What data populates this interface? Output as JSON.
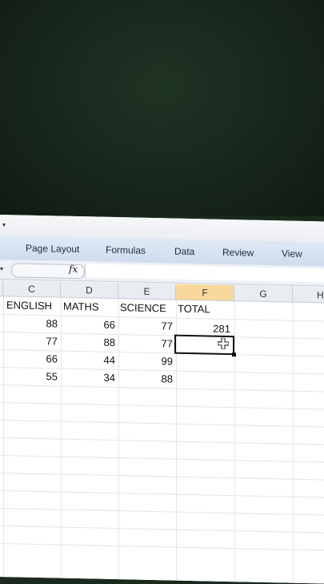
{
  "ribbon": {
    "tabs": [
      "Page Layout",
      "Formulas",
      "Data",
      "Review",
      "View"
    ]
  },
  "formula_bar": {
    "fx_label": "fx",
    "value": ""
  },
  "columns": [
    "C",
    "D",
    "E",
    "F",
    "G",
    "H"
  ],
  "active_column": "F",
  "sheet": {
    "headers": [
      "ENGLISH",
      "MATHS",
      "SCIENCE",
      "TOTAL"
    ],
    "rows": [
      [
        "88",
        "66",
        "77",
        "281"
      ],
      [
        "77",
        "88",
        "77",
        ""
      ],
      [
        "66",
        "44",
        "99",
        ""
      ],
      [
        "55",
        "34",
        "88",
        ""
      ]
    ]
  },
  "colors": {
    "active_column_header": "#f9d99b",
    "ribbon": "#cfdcee"
  }
}
